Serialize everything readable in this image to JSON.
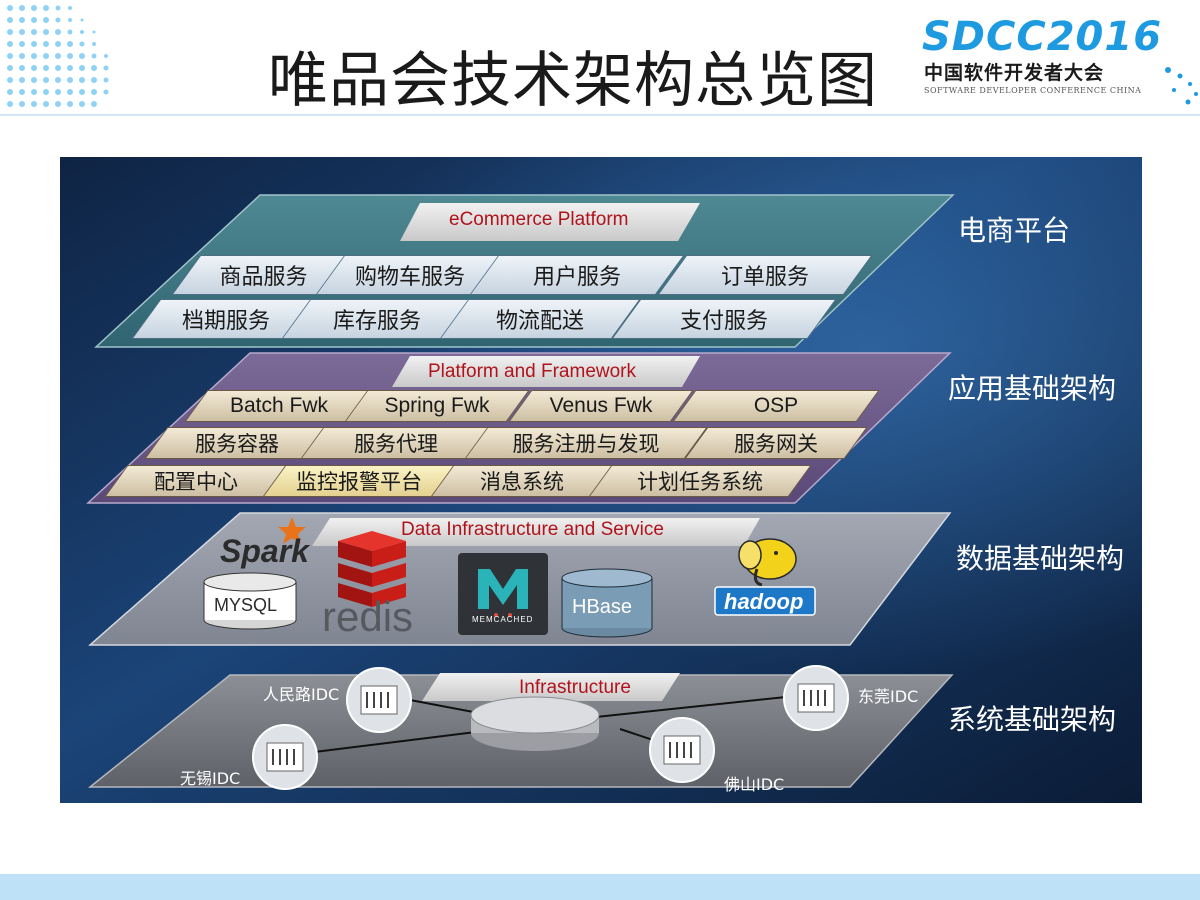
{
  "slide": {
    "title": "唯品会技术架构总览图",
    "conference": {
      "name": "SDCC2016",
      "cn": "中国软件开发者大会",
      "en": "SOFTWARE DEVELOPER CONFERENCE CHINA"
    }
  },
  "layers": {
    "ecommerce": {
      "title": "eCommerce Platform",
      "side_label": "电商平台",
      "row1": [
        "商品服务",
        "购物车服务",
        "用户服务",
        "订单服务"
      ],
      "row2": [
        "档期服务",
        "库存服务",
        "物流配送",
        "支付服务"
      ]
    },
    "framework": {
      "title": "Platform and Framework",
      "side_label": "应用基础架构",
      "row1": [
        "Batch Fwk",
        "Spring Fwk",
        "Venus Fwk",
        "OSP"
      ],
      "row2": [
        "服务容器",
        "服务代理",
        "服务注册与发现",
        "服务网关"
      ],
      "row3": [
        "配置中心",
        "监控报警平台",
        "消息系统",
        "计划任务系统"
      ]
    },
    "data": {
      "title": "Data Infrastructure and Service",
      "side_label": "数据基础架构",
      "logos": {
        "spark": "Spark",
        "mysql": "MYSQL",
        "redis": "redis",
        "memcached": "MEMCACHED",
        "hbase": "HBase",
        "hadoop": "hadoop"
      }
    },
    "infra": {
      "title": "Infrastructure",
      "side_label": "系统基础架构",
      "idcs": [
        "人民路IDC",
        "东莞IDC",
        "无锡IDC",
        "佛山IDC"
      ]
    }
  },
  "colors": {
    "background": "#16365e",
    "layer_title": "#b0131b",
    "accent": "#1e9be0"
  }
}
